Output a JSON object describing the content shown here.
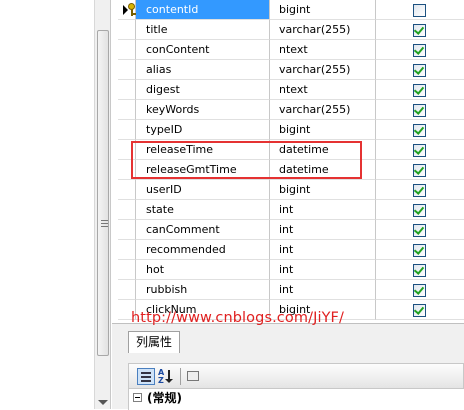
{
  "columns": [
    {
      "name": "contentId",
      "type": "bigint",
      "allow_nulls": false,
      "primary_key": true,
      "selected": true
    },
    {
      "name": "title",
      "type": "varchar(255)",
      "allow_nulls": true
    },
    {
      "name": "conContent",
      "type": "ntext",
      "allow_nulls": true
    },
    {
      "name": "alias",
      "type": "varchar(255)",
      "allow_nulls": true
    },
    {
      "name": "digest",
      "type": "ntext",
      "allow_nulls": true
    },
    {
      "name": "keyWords",
      "type": "varchar(255)",
      "allow_nulls": true
    },
    {
      "name": "typeID",
      "type": "bigint",
      "allow_nulls": true
    },
    {
      "name": "releaseTime",
      "type": "datetime",
      "allow_nulls": true
    },
    {
      "name": "releaseGmtTime",
      "type": "datetime",
      "allow_nulls": true
    },
    {
      "name": "userID",
      "type": "bigint",
      "allow_nulls": true
    },
    {
      "name": "state",
      "type": "int",
      "allow_nulls": true
    },
    {
      "name": "canComment",
      "type": "int",
      "allow_nulls": true
    },
    {
      "name": "recommended",
      "type": "int",
      "allow_nulls": true
    },
    {
      "name": "hot",
      "type": "int",
      "allow_nulls": true
    },
    {
      "name": "rubbish",
      "type": "int",
      "allow_nulls": true
    },
    {
      "name": "clickNum",
      "type": "bigint",
      "allow_nulls": true
    }
  ],
  "watermark": "http://www.cnblogs.com/JiYF/",
  "properties": {
    "tab_label": "列属性",
    "section_label": "(常规)"
  },
  "colors": {
    "selection": "#3399ff",
    "highlight_border": "#e53232",
    "watermark": "#e02020",
    "checkmark": "#21a121"
  },
  "icons": {
    "primary_key": "key-icon",
    "current_row": "row-pointer-icon",
    "categorized": "categorized-icon",
    "alphabetical": "sort-az-icon",
    "property_pages": "property-pages-icon"
  }
}
